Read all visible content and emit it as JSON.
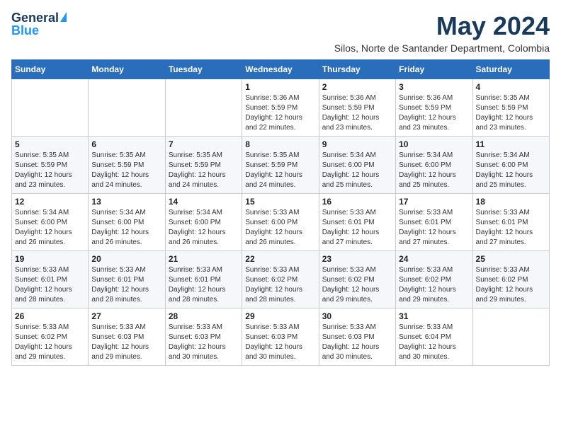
{
  "logo": {
    "line1": "General",
    "line2": "Blue"
  },
  "header": {
    "month": "May 2024",
    "location": "Silos, Norte de Santander Department, Colombia"
  },
  "days_of_week": [
    "Sunday",
    "Monday",
    "Tuesday",
    "Wednesday",
    "Thursday",
    "Friday",
    "Saturday"
  ],
  "weeks": [
    [
      {
        "day": "",
        "info": ""
      },
      {
        "day": "",
        "info": ""
      },
      {
        "day": "",
        "info": ""
      },
      {
        "day": "1",
        "info": "Sunrise: 5:36 AM\nSunset: 5:59 PM\nDaylight: 12 hours and 22 minutes."
      },
      {
        "day": "2",
        "info": "Sunrise: 5:36 AM\nSunset: 5:59 PM\nDaylight: 12 hours and 23 minutes."
      },
      {
        "day": "3",
        "info": "Sunrise: 5:36 AM\nSunset: 5:59 PM\nDaylight: 12 hours and 23 minutes."
      },
      {
        "day": "4",
        "info": "Sunrise: 5:35 AM\nSunset: 5:59 PM\nDaylight: 12 hours and 23 minutes."
      }
    ],
    [
      {
        "day": "5",
        "info": "Sunrise: 5:35 AM\nSunset: 5:59 PM\nDaylight: 12 hours and 23 minutes."
      },
      {
        "day": "6",
        "info": "Sunrise: 5:35 AM\nSunset: 5:59 PM\nDaylight: 12 hours and 24 minutes."
      },
      {
        "day": "7",
        "info": "Sunrise: 5:35 AM\nSunset: 5:59 PM\nDaylight: 12 hours and 24 minutes."
      },
      {
        "day": "8",
        "info": "Sunrise: 5:35 AM\nSunset: 5:59 PM\nDaylight: 12 hours and 24 minutes."
      },
      {
        "day": "9",
        "info": "Sunrise: 5:34 AM\nSunset: 6:00 PM\nDaylight: 12 hours and 25 minutes."
      },
      {
        "day": "10",
        "info": "Sunrise: 5:34 AM\nSunset: 6:00 PM\nDaylight: 12 hours and 25 minutes."
      },
      {
        "day": "11",
        "info": "Sunrise: 5:34 AM\nSunset: 6:00 PM\nDaylight: 12 hours and 25 minutes."
      }
    ],
    [
      {
        "day": "12",
        "info": "Sunrise: 5:34 AM\nSunset: 6:00 PM\nDaylight: 12 hours and 26 minutes."
      },
      {
        "day": "13",
        "info": "Sunrise: 5:34 AM\nSunset: 6:00 PM\nDaylight: 12 hours and 26 minutes."
      },
      {
        "day": "14",
        "info": "Sunrise: 5:34 AM\nSunset: 6:00 PM\nDaylight: 12 hours and 26 minutes."
      },
      {
        "day": "15",
        "info": "Sunrise: 5:33 AM\nSunset: 6:00 PM\nDaylight: 12 hours and 26 minutes."
      },
      {
        "day": "16",
        "info": "Sunrise: 5:33 AM\nSunset: 6:01 PM\nDaylight: 12 hours and 27 minutes."
      },
      {
        "day": "17",
        "info": "Sunrise: 5:33 AM\nSunset: 6:01 PM\nDaylight: 12 hours and 27 minutes."
      },
      {
        "day": "18",
        "info": "Sunrise: 5:33 AM\nSunset: 6:01 PM\nDaylight: 12 hours and 27 minutes."
      }
    ],
    [
      {
        "day": "19",
        "info": "Sunrise: 5:33 AM\nSunset: 6:01 PM\nDaylight: 12 hours and 28 minutes."
      },
      {
        "day": "20",
        "info": "Sunrise: 5:33 AM\nSunset: 6:01 PM\nDaylight: 12 hours and 28 minutes."
      },
      {
        "day": "21",
        "info": "Sunrise: 5:33 AM\nSunset: 6:01 PM\nDaylight: 12 hours and 28 minutes."
      },
      {
        "day": "22",
        "info": "Sunrise: 5:33 AM\nSunset: 6:02 PM\nDaylight: 12 hours and 28 minutes."
      },
      {
        "day": "23",
        "info": "Sunrise: 5:33 AM\nSunset: 6:02 PM\nDaylight: 12 hours and 29 minutes."
      },
      {
        "day": "24",
        "info": "Sunrise: 5:33 AM\nSunset: 6:02 PM\nDaylight: 12 hours and 29 minutes."
      },
      {
        "day": "25",
        "info": "Sunrise: 5:33 AM\nSunset: 6:02 PM\nDaylight: 12 hours and 29 minutes."
      }
    ],
    [
      {
        "day": "26",
        "info": "Sunrise: 5:33 AM\nSunset: 6:02 PM\nDaylight: 12 hours and 29 minutes."
      },
      {
        "day": "27",
        "info": "Sunrise: 5:33 AM\nSunset: 6:03 PM\nDaylight: 12 hours and 29 minutes."
      },
      {
        "day": "28",
        "info": "Sunrise: 5:33 AM\nSunset: 6:03 PM\nDaylight: 12 hours and 30 minutes."
      },
      {
        "day": "29",
        "info": "Sunrise: 5:33 AM\nSunset: 6:03 PM\nDaylight: 12 hours and 30 minutes."
      },
      {
        "day": "30",
        "info": "Sunrise: 5:33 AM\nSunset: 6:03 PM\nDaylight: 12 hours and 30 minutes."
      },
      {
        "day": "31",
        "info": "Sunrise: 5:33 AM\nSunset: 6:04 PM\nDaylight: 12 hours and 30 minutes."
      },
      {
        "day": "",
        "info": ""
      }
    ]
  ]
}
